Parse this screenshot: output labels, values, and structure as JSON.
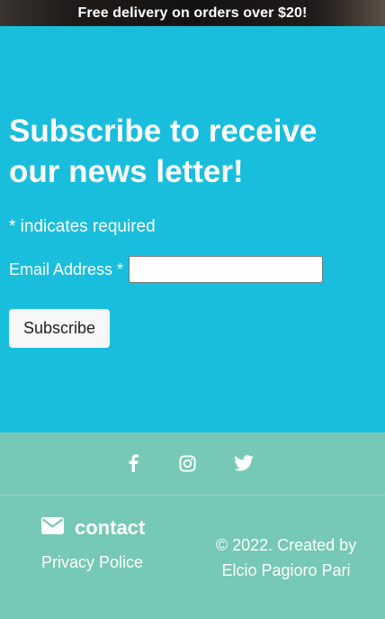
{
  "banner": {
    "text": "Free delivery on orders over $20!"
  },
  "subscribe": {
    "title": "Subscribe to receive our news letter!",
    "required_note": "* indicates required",
    "email_label": "Email Address *",
    "email_value": "",
    "button_label": "Subscribe",
    "background_color": "#1abedd"
  },
  "footer": {
    "background_color": "#76c9b4",
    "social_icons": [
      "facebook-icon",
      "instagram-icon",
      "twitter-icon"
    ],
    "contact_label": "contact",
    "contact_icon": "envelope-icon",
    "privacy_label": "Privacy Police",
    "copyright": "© 2022. Created by Elcio Pagioro Pari"
  }
}
